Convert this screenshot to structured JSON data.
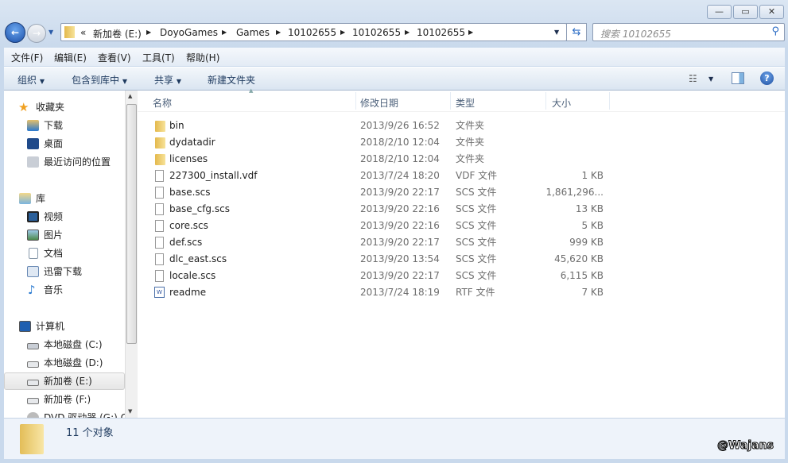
{
  "window": {
    "controls": {
      "minimize": "—",
      "maximize": "▭",
      "close": "✕"
    }
  },
  "address": {
    "overflow": "«",
    "crumbs": [
      "新加卷 (E:)",
      "DoyoGames",
      "Games",
      "10102655",
      "10102655",
      "10102655"
    ]
  },
  "search": {
    "placeholder": "搜索 10102655"
  },
  "menu": [
    "文件(F)",
    "编辑(E)",
    "查看(V)",
    "工具(T)",
    "帮助(H)"
  ],
  "toolbar": {
    "organize": "组织",
    "include_library": "包含到库中",
    "share": "共享",
    "new_folder": "新建文件夹"
  },
  "nav": {
    "favorites": {
      "label": "收藏夹",
      "items": [
        "下载",
        "桌面",
        "最近访问的位置"
      ]
    },
    "libraries": {
      "label": "库",
      "items": [
        "视频",
        "图片",
        "文档",
        "迅雷下载",
        "音乐"
      ]
    },
    "computer": {
      "label": "计算机",
      "items": [
        "本地磁盘 (C:)",
        "本地磁盘 (D:)",
        "新加卷 (E:)",
        "新加卷 (F:)",
        "DVD 驱动器 (G:) C"
      ],
      "selected": "新加卷 (E:)"
    }
  },
  "columns": {
    "name": "名称",
    "date": "修改日期",
    "type": "类型",
    "size": "大小"
  },
  "files": [
    {
      "name": "bin",
      "date": "2013/9/26 16:52",
      "type": "文件夹",
      "size": "",
      "icon": "folder"
    },
    {
      "name": "dydatadir",
      "date": "2018/2/10 12:04",
      "type": "文件夹",
      "size": "",
      "icon": "folder"
    },
    {
      "name": "licenses",
      "date": "2018/2/10 12:04",
      "type": "文件夹",
      "size": "",
      "icon": "folder"
    },
    {
      "name": "227300_install.vdf",
      "date": "2013/7/24 18:20",
      "type": "VDF 文件",
      "size": "1 KB",
      "icon": "file"
    },
    {
      "name": "base.scs",
      "date": "2013/9/20 22:17",
      "type": "SCS 文件",
      "size": "1,861,296...",
      "icon": "file"
    },
    {
      "name": "base_cfg.scs",
      "date": "2013/9/20 22:16",
      "type": "SCS 文件",
      "size": "13 KB",
      "icon": "file"
    },
    {
      "name": "core.scs",
      "date": "2013/9/20 22:16",
      "type": "SCS 文件",
      "size": "5 KB",
      "icon": "file"
    },
    {
      "name": "def.scs",
      "date": "2013/9/20 22:17",
      "type": "SCS 文件",
      "size": "999 KB",
      "icon": "file"
    },
    {
      "name": "dlc_east.scs",
      "date": "2013/9/20 13:54",
      "type": "SCS 文件",
      "size": "45,620 KB",
      "icon": "file"
    },
    {
      "name": "locale.scs",
      "date": "2013/9/20 22:17",
      "type": "SCS 文件",
      "size": "6,115 KB",
      "icon": "file"
    },
    {
      "name": "readme",
      "date": "2013/7/24 18:19",
      "type": "RTF 文件",
      "size": "7 KB",
      "icon": "rtf"
    }
  ],
  "status": {
    "count": "11 个对象"
  },
  "watermark": "@Wajans"
}
